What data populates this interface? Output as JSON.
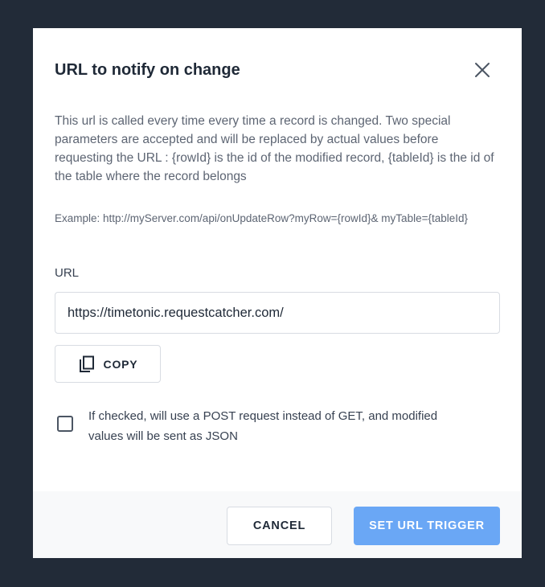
{
  "dialog": {
    "title": "URL to notify on change",
    "close_icon": "close-icon",
    "description": "This url is called every time every time a record is changed. Two special parameters are accepted and will be replaced by actual values before requesting the URL : {rowId} is the id of the modified record, {tableId} is the id of the table where the record belongs",
    "example": "Example: http://myServer.com/api/onUpdateRow?myRow={rowId}& myTable={tableId}"
  },
  "url_field": {
    "label": "URL",
    "value": "https://timetonic.requestcatcher.com/"
  },
  "copy_button": {
    "icon": "copy-icon",
    "label": "COPY"
  },
  "post_option": {
    "checked": false,
    "label": "If checked, will use a POST request instead of GET, and modified values will be sent as JSON"
  },
  "footer": {
    "cancel_label": "CANCEL",
    "submit_label": "SET URL TRIGGER"
  },
  "colors": {
    "backdrop": "#222b38",
    "primary_button": "#6aa7f5",
    "footer_bg": "#f8f9fa"
  }
}
